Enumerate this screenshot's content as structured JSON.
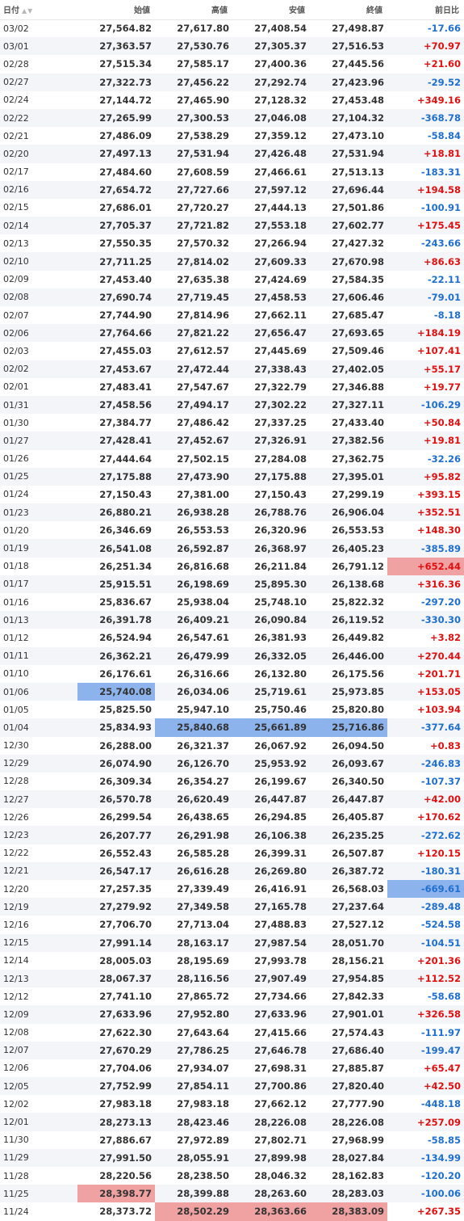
{
  "headers": [
    "日付",
    "始値",
    "高値",
    "安値",
    "終値",
    "前日比"
  ],
  "sort_icon": "sort-arrows-icon",
  "rows": [
    {
      "date": "03/02",
      "open": "27,564.82",
      "high": "27,617.80",
      "low": "27,408.54",
      "close": "27,498.87",
      "change": "-17.66"
    },
    {
      "date": "03/01",
      "open": "27,363.57",
      "high": "27,530.76",
      "low": "27,305.37",
      "close": "27,516.53",
      "change": "+70.97"
    },
    {
      "date": "02/28",
      "open": "27,515.34",
      "high": "27,585.17",
      "low": "27,400.36",
      "close": "27,445.56",
      "change": "+21.60"
    },
    {
      "date": "02/27",
      "open": "27,322.73",
      "high": "27,456.22",
      "low": "27,292.74",
      "close": "27,423.96",
      "change": "-29.52"
    },
    {
      "date": "02/24",
      "open": "27,144.72",
      "high": "27,465.90",
      "low": "27,128.32",
      "close": "27,453.48",
      "change": "+349.16"
    },
    {
      "date": "02/22",
      "open": "27,265.99",
      "high": "27,300.53",
      "low": "27,046.08",
      "close": "27,104.32",
      "change": "-368.78"
    },
    {
      "date": "02/21",
      "open": "27,486.09",
      "high": "27,538.29",
      "low": "27,359.12",
      "close": "27,473.10",
      "change": "-58.84"
    },
    {
      "date": "02/20",
      "open": "27,497.13",
      "high": "27,531.94",
      "low": "27,426.48",
      "close": "27,531.94",
      "change": "+18.81"
    },
    {
      "date": "02/17",
      "open": "27,484.60",
      "high": "27,608.59",
      "low": "27,466.61",
      "close": "27,513.13",
      "change": "-183.31"
    },
    {
      "date": "02/16",
      "open": "27,654.72",
      "high": "27,727.66",
      "low": "27,597.12",
      "close": "27,696.44",
      "change": "+194.58"
    },
    {
      "date": "02/15",
      "open": "27,686.01",
      "high": "27,720.27",
      "low": "27,444.13",
      "close": "27,501.86",
      "change": "-100.91"
    },
    {
      "date": "02/14",
      "open": "27,705.37",
      "high": "27,721.82",
      "low": "27,553.18",
      "close": "27,602.77",
      "change": "+175.45"
    },
    {
      "date": "02/13",
      "open": "27,550.35",
      "high": "27,570.32",
      "low": "27,266.94",
      "close": "27,427.32",
      "change": "-243.66"
    },
    {
      "date": "02/10",
      "open": "27,711.25",
      "high": "27,814.02",
      "low": "27,609.33",
      "close": "27,670.98",
      "change": "+86.63"
    },
    {
      "date": "02/09",
      "open": "27,453.40",
      "high": "27,635.38",
      "low": "27,424.69",
      "close": "27,584.35",
      "change": "-22.11"
    },
    {
      "date": "02/08",
      "open": "27,690.74",
      "high": "27,719.45",
      "low": "27,458.53",
      "close": "27,606.46",
      "change": "-79.01"
    },
    {
      "date": "02/07",
      "open": "27,744.90",
      "high": "27,814.96",
      "low": "27,662.11",
      "close": "27,685.47",
      "change": "-8.18"
    },
    {
      "date": "02/06",
      "open": "27,764.66",
      "high": "27,821.22",
      "low": "27,656.47",
      "close": "27,693.65",
      "change": "+184.19"
    },
    {
      "date": "02/03",
      "open": "27,455.03",
      "high": "27,612.57",
      "low": "27,445.69",
      "close": "27,509.46",
      "change": "+107.41"
    },
    {
      "date": "02/02",
      "open": "27,453.67",
      "high": "27,472.44",
      "low": "27,338.43",
      "close": "27,402.05",
      "change": "+55.17"
    },
    {
      "date": "02/01",
      "open": "27,483.41",
      "high": "27,547.67",
      "low": "27,322.79",
      "close": "27,346.88",
      "change": "+19.77"
    },
    {
      "date": "01/31",
      "open": "27,458.56",
      "high": "27,494.17",
      "low": "27,302.22",
      "close": "27,327.11",
      "change": "-106.29"
    },
    {
      "date": "01/30",
      "open": "27,384.77",
      "high": "27,486.42",
      "low": "27,337.25",
      "close": "27,433.40",
      "change": "+50.84"
    },
    {
      "date": "01/27",
      "open": "27,428.41",
      "high": "27,452.67",
      "low": "27,326.91",
      "close": "27,382.56",
      "change": "+19.81"
    },
    {
      "date": "01/26",
      "open": "27,444.64",
      "high": "27,502.15",
      "low": "27,284.08",
      "close": "27,362.75",
      "change": "-32.26"
    },
    {
      "date": "01/25",
      "open": "27,175.88",
      "high": "27,473.90",
      "low": "27,175.88",
      "close": "27,395.01",
      "change": "+95.82"
    },
    {
      "date": "01/24",
      "open": "27,150.43",
      "high": "27,381.00",
      "low": "27,150.43",
      "close": "27,299.19",
      "change": "+393.15"
    },
    {
      "date": "01/23",
      "open": "26,880.21",
      "high": "26,938.28",
      "low": "26,788.76",
      "close": "26,906.04",
      "change": "+352.51"
    },
    {
      "date": "01/20",
      "open": "26,346.69",
      "high": "26,553.53",
      "low": "26,320.96",
      "close": "26,553.53",
      "change": "+148.30"
    },
    {
      "date": "01/19",
      "open": "26,541.08",
      "high": "26,592.87",
      "low": "26,368.97",
      "close": "26,405.23",
      "change": "-385.89"
    },
    {
      "date": "01/18",
      "open": "26,251.34",
      "high": "26,816.68",
      "low": "26,211.84",
      "close": "26,791.12",
      "change": "+652.44"
    },
    {
      "date": "01/17",
      "open": "25,915.51",
      "high": "26,198.69",
      "low": "25,895.30",
      "close": "26,138.68",
      "change": "+316.36"
    },
    {
      "date": "01/16",
      "open": "25,836.67",
      "high": "25,938.04",
      "low": "25,748.10",
      "close": "25,822.32",
      "change": "-297.20"
    },
    {
      "date": "01/13",
      "open": "26,391.78",
      "high": "26,409.21",
      "low": "26,090.84",
      "close": "26,119.52",
      "change": "-330.30"
    },
    {
      "date": "01/12",
      "open": "26,524.94",
      "high": "26,547.61",
      "low": "26,381.93",
      "close": "26,449.82",
      "change": "+3.82"
    },
    {
      "date": "01/11",
      "open": "26,362.21",
      "high": "26,479.99",
      "low": "26,332.05",
      "close": "26,446.00",
      "change": "+270.44"
    },
    {
      "date": "01/10",
      "open": "26,176.61",
      "high": "26,316.66",
      "low": "26,132.80",
      "close": "26,175.56",
      "change": "+201.71"
    },
    {
      "date": "01/06",
      "open": "25,740.08",
      "high": "26,034.06",
      "low": "25,719.61",
      "close": "25,973.85",
      "change": "+153.05"
    },
    {
      "date": "01/05",
      "open": "25,825.50",
      "high": "25,947.10",
      "low": "25,750.46",
      "close": "25,820.80",
      "change": "+103.94"
    },
    {
      "date": "01/04",
      "open": "25,834.93",
      "high": "25,840.68",
      "low": "25,661.89",
      "close": "25,716.86",
      "change": "-377.64"
    },
    {
      "date": "12/30",
      "open": "26,288.00",
      "high": "26,321.37",
      "low": "26,067.92",
      "close": "26,094.50",
      "change": "+0.83"
    },
    {
      "date": "12/29",
      "open": "26,074.90",
      "high": "26,126.70",
      "low": "25,953.92",
      "close": "26,093.67",
      "change": "-246.83"
    },
    {
      "date": "12/28",
      "open": "26,309.34",
      "high": "26,354.27",
      "low": "26,199.67",
      "close": "26,340.50",
      "change": "-107.37"
    },
    {
      "date": "12/27",
      "open": "26,570.78",
      "high": "26,620.49",
      "low": "26,447.87",
      "close": "26,447.87",
      "change": "+42.00"
    },
    {
      "date": "12/26",
      "open": "26,299.54",
      "high": "26,438.65",
      "low": "26,294.85",
      "close": "26,405.87",
      "change": "+170.62"
    },
    {
      "date": "12/23",
      "open": "26,207.77",
      "high": "26,291.98",
      "low": "26,106.38",
      "close": "26,235.25",
      "change": "-272.62"
    },
    {
      "date": "12/22",
      "open": "26,552.43",
      "high": "26,585.28",
      "low": "26,399.31",
      "close": "26,507.87",
      "change": "+120.15"
    },
    {
      "date": "12/21",
      "open": "26,547.17",
      "high": "26,616.28",
      "low": "26,269.80",
      "close": "26,387.72",
      "change": "-180.31"
    },
    {
      "date": "12/20",
      "open": "27,257.35",
      "high": "27,339.49",
      "low": "26,416.91",
      "close": "26,568.03",
      "change": "-669.61"
    },
    {
      "date": "12/19",
      "open": "27,279.92",
      "high": "27,349.58",
      "low": "27,165.78",
      "close": "27,237.64",
      "change": "-289.48"
    },
    {
      "date": "12/16",
      "open": "27,706.70",
      "high": "27,713.04",
      "low": "27,488.83",
      "close": "27,527.12",
      "change": "-524.58"
    },
    {
      "date": "12/15",
      "open": "27,991.14",
      "high": "28,163.17",
      "low": "27,987.54",
      "close": "28,051.70",
      "change": "-104.51"
    },
    {
      "date": "12/14",
      "open": "28,005.03",
      "high": "28,195.69",
      "low": "27,993.78",
      "close": "28,156.21",
      "change": "+201.36"
    },
    {
      "date": "12/13",
      "open": "28,067.37",
      "high": "28,116.56",
      "low": "27,907.49",
      "close": "27,954.85",
      "change": "+112.52"
    },
    {
      "date": "12/12",
      "open": "27,741.10",
      "high": "27,865.72",
      "low": "27,734.66",
      "close": "27,842.33",
      "change": "-58.68"
    },
    {
      "date": "12/09",
      "open": "27,633.96",
      "high": "27,952.80",
      "low": "27,633.96",
      "close": "27,901.01",
      "change": "+326.58"
    },
    {
      "date": "12/08",
      "open": "27,622.30",
      "high": "27,643.64",
      "low": "27,415.66",
      "close": "27,574.43",
      "change": "-111.97"
    },
    {
      "date": "12/07",
      "open": "27,670.29",
      "high": "27,786.25",
      "low": "27,646.78",
      "close": "27,686.40",
      "change": "-199.47"
    },
    {
      "date": "12/06",
      "open": "27,704.06",
      "high": "27,934.07",
      "low": "27,698.31",
      "close": "27,885.87",
      "change": "+65.47"
    },
    {
      "date": "12/05",
      "open": "27,752.99",
      "high": "27,854.11",
      "low": "27,700.86",
      "close": "27,820.40",
      "change": "+42.50"
    },
    {
      "date": "12/02",
      "open": "27,983.18",
      "high": "27,983.18",
      "low": "27,662.12",
      "close": "27,777.90",
      "change": "-448.18"
    },
    {
      "date": "12/01",
      "open": "28,273.13",
      "high": "28,423.46",
      "low": "28,226.08",
      "close": "28,226.08",
      "change": "+257.09"
    },
    {
      "date": "11/30",
      "open": "27,886.67",
      "high": "27,972.89",
      "low": "27,802.71",
      "close": "27,968.99",
      "change": "-58.85"
    },
    {
      "date": "11/29",
      "open": "27,991.50",
      "high": "28,055.91",
      "low": "27,899.98",
      "close": "28,027.84",
      "change": "-134.99"
    },
    {
      "date": "11/28",
      "open": "28,220.56",
      "high": "28,238.50",
      "low": "28,046.32",
      "close": "28,162.83",
      "change": "-120.20"
    },
    {
      "date": "11/25",
      "open": "28,398.77",
      "high": "28,399.88",
      "low": "28,263.60",
      "close": "28,283.03",
      "change": "-100.06"
    },
    {
      "date": "11/24",
      "open": "28,373.72",
      "high": "28,502.29",
      "low": "28,363.66",
      "close": "28,383.09",
      "change": "+267.35"
    }
  ],
  "highlights": {
    "low": [
      {
        "date": "01/06",
        "field": "open"
      },
      {
        "date": "01/04",
        "field": "high"
      },
      {
        "date": "01/04",
        "field": "low"
      },
      {
        "date": "01/04",
        "field": "close"
      },
      {
        "date": "12/20",
        "field": "change"
      }
    ],
    "high": [
      {
        "date": "01/18",
        "field": "change"
      },
      {
        "date": "11/25",
        "field": "open"
      },
      {
        "date": "11/24",
        "field": "high"
      },
      {
        "date": "11/24",
        "field": "low"
      },
      {
        "date": "11/24",
        "field": "close"
      }
    ]
  },
  "colors": {
    "positive": "#e01010",
    "negative": "#1f6fcf",
    "highlight_low": "#8cb3ec",
    "highlight_high": "#f0a1a1"
  }
}
